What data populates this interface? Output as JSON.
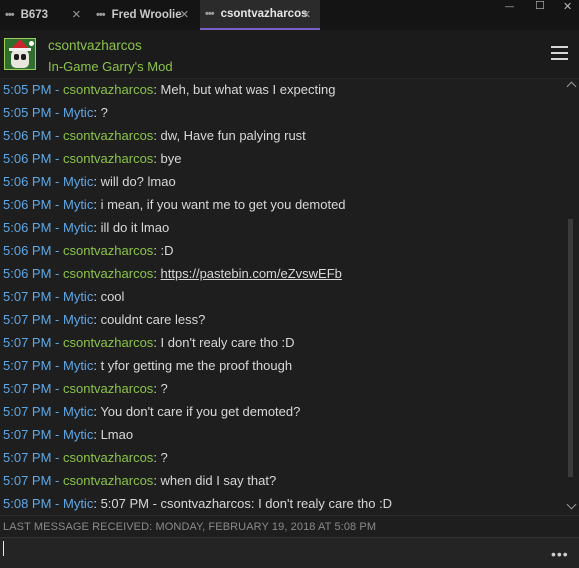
{
  "tabs": [
    {
      "dots": "•••",
      "label": "B673",
      "close": "×"
    },
    {
      "dots": "•••",
      "label": "Fred Wroolie",
      "close": "×"
    },
    {
      "dots": "•••",
      "label": "csontvazharcos",
      "close": "×"
    }
  ],
  "window_controls": {
    "minimize": "—",
    "maximize": "☐",
    "close": "✕"
  },
  "header": {
    "friend_name": "csontvazharcos",
    "status": "In-Game Garry's Mod"
  },
  "messages": [
    {
      "time": "5:05 PM",
      "sender": "csontvazharcos",
      "kind": "self",
      "text": "Meh, but what was I expecting"
    },
    {
      "time": "5:05 PM",
      "sender": "Mytic",
      "kind": "other",
      "text": "?"
    },
    {
      "time": "5:06 PM",
      "sender": "csontvazharcos",
      "kind": "self",
      "text": "dw, Have fun palying rust"
    },
    {
      "time": "5:06 PM",
      "sender": "csontvazharcos",
      "kind": "self",
      "text": "bye"
    },
    {
      "time": "5:06 PM",
      "sender": "Mytic",
      "kind": "other",
      "text": "will do? lmao"
    },
    {
      "time": "5:06 PM",
      "sender": "Mytic",
      "kind": "other",
      "text": "i mean, if you want me to get you demoted"
    },
    {
      "time": "5:06 PM",
      "sender": "Mytic",
      "kind": "other",
      "text": "ill do it lmao"
    },
    {
      "time": "5:06 PM",
      "sender": "csontvazharcos",
      "kind": "self",
      "text": ":D"
    },
    {
      "time": "5:06 PM",
      "sender": "csontvazharcos",
      "kind": "self",
      "text": "https://pastebin.com/eZvswEFb",
      "is_link": true
    },
    {
      "time": "5:07 PM",
      "sender": "Mytic",
      "kind": "other",
      "text": "cool"
    },
    {
      "time": "5:07 PM",
      "sender": "Mytic",
      "kind": "other",
      "text": "couldnt care less?"
    },
    {
      "time": "5:07 PM",
      "sender": "csontvazharcos",
      "kind": "self",
      "text": "I don't realy care tho :D"
    },
    {
      "time": "5:07 PM",
      "sender": "Mytic",
      "kind": "other",
      "text": "t yfor getting me the proof though"
    },
    {
      "time": "5:07 PM",
      "sender": "csontvazharcos",
      "kind": "self",
      "text": "?"
    },
    {
      "time": "5:07 PM",
      "sender": "Mytic",
      "kind": "other",
      "text": "You don't care if you get demoted?"
    },
    {
      "time": "5:07 PM",
      "sender": "Mytic",
      "kind": "other",
      "text": "Lmao"
    },
    {
      "time": "5:07 PM",
      "sender": "csontvazharcos",
      "kind": "self",
      "text": "?"
    },
    {
      "time": "5:07 PM",
      "sender": "csontvazharcos",
      "kind": "self",
      "text": "when did I say that?"
    },
    {
      "time": "5:08 PM",
      "sender": "Mytic",
      "kind": "other",
      "text": "5:07 PM - csontvazharcos: I don't realy care tho :D"
    }
  ],
  "separator": " - ",
  "colon": ": ",
  "last_message": "LAST MESSAGE RECEIVED: MONDAY, FEBRUARY 19, 2018 AT 5:08 PM",
  "input": {
    "value": "",
    "more": "•••"
  },
  "colors": {
    "self": "#8bc34a",
    "other": "#5fa8e8",
    "accent": "#7a5fc9"
  },
  "icons": {
    "menu": "hamburger-icon",
    "more": "more-icon",
    "avatar": "santa-skull-avatar"
  }
}
